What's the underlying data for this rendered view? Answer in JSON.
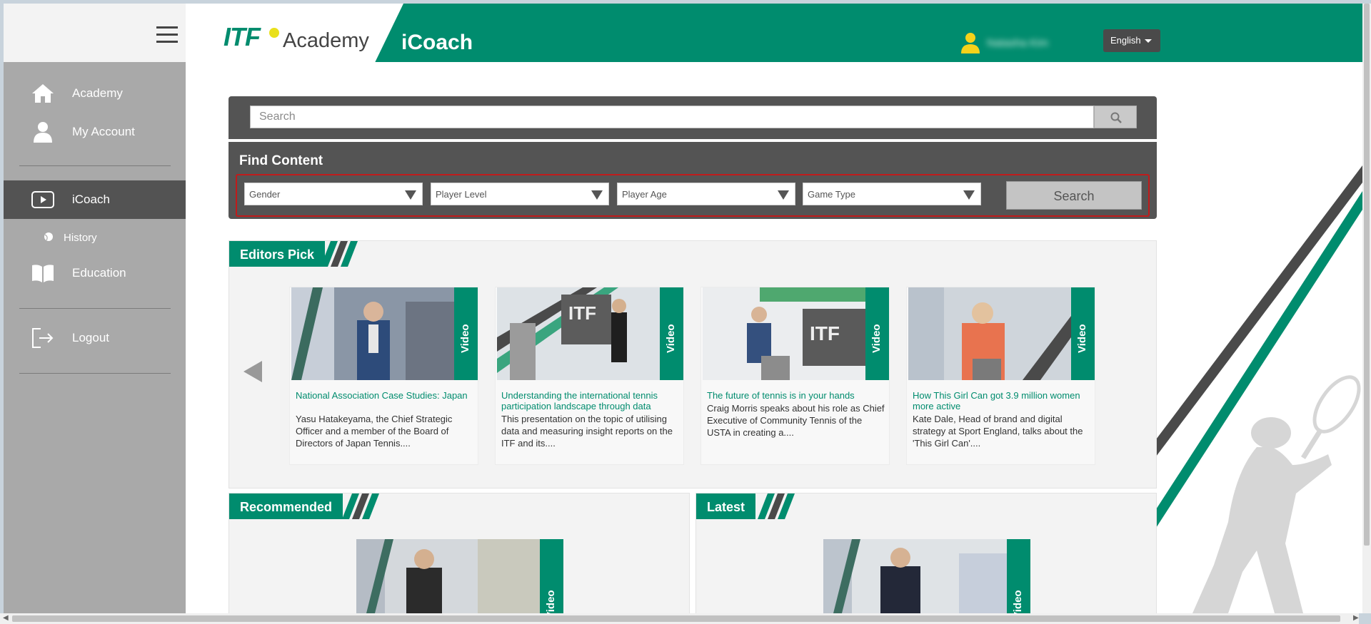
{
  "header": {
    "logo_itf": "ITF",
    "logo_academy": "Academy",
    "app_title": "iCoach",
    "user_name": "Natasha Kim",
    "language": "English"
  },
  "sidebar": {
    "items": [
      {
        "label": "Academy",
        "icon": "home-icon"
      },
      {
        "label": "My Account",
        "icon": "user-icon"
      },
      {
        "label": "iCoach",
        "icon": "play-icon"
      },
      {
        "label": "History",
        "icon": "ball-icon"
      },
      {
        "label": "Education",
        "icon": "book-icon"
      },
      {
        "label": "Logout",
        "icon": "logout-icon"
      }
    ]
  },
  "search": {
    "placeholder": "Search"
  },
  "find_content": {
    "title": "Find Content",
    "filters": [
      "Gender",
      "Player Level",
      "Player Age",
      "Game Type"
    ],
    "search_label": "Search"
  },
  "editors_pick": {
    "title": "Editors Pick",
    "cards": [
      {
        "badge": "Video",
        "title": "National Association Case Studies: Japan",
        "description": "Yasu Hatakeyama, the Chief Strategic Officer and a member of the Board of Directors of Japan Tennis...."
      },
      {
        "badge": "Video",
        "title": "Understanding the international tennis participation landscape through data",
        "description": "This presentation on the topic of utilising data and measuring insight reports on the ITF and its...."
      },
      {
        "badge": "Video",
        "title": "The future of tennis is in your hands",
        "description": "Craig Morris speaks about his role as Chief Executive of Community Tennis of the USTA in creating a...."
      },
      {
        "badge": "Video",
        "title": "How This Girl Can got 3.9 million women more active",
        "description": "Kate Dale, Head of brand and digital strategy at Sport England, talks about the 'This Girl Can'...."
      }
    ]
  },
  "recommended": {
    "title": "Recommended",
    "badge": "Video"
  },
  "latest": {
    "title": "Latest",
    "badge": "Video"
  },
  "colors": {
    "brand_green": "#008c6e",
    "dark_grey": "#545454",
    "sidebar_grey": "#a9a9a9",
    "highlight_red": "#c01b1b"
  }
}
